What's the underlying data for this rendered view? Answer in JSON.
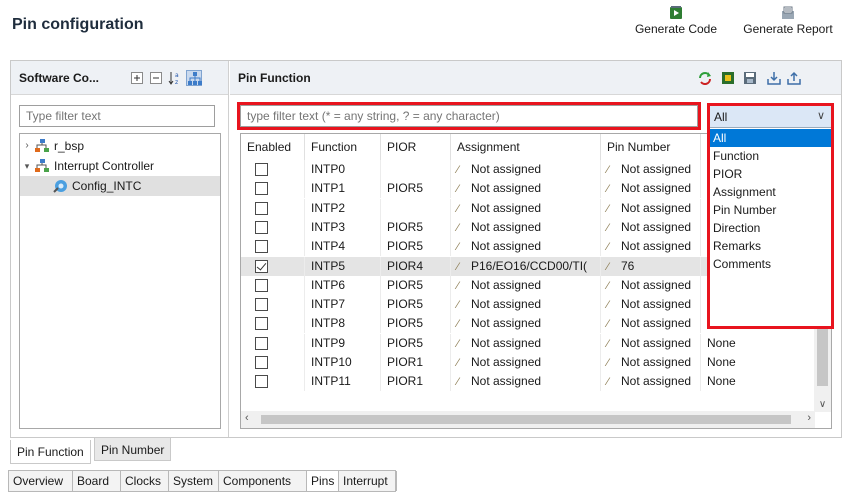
{
  "header": {
    "title": "Pin configuration",
    "generate_code": "Generate Code",
    "generate_report": "Generate Report"
  },
  "left_panel": {
    "title": "Software Co...",
    "filter_placeholder": "Type filter text",
    "tree": [
      {
        "label": "r_bsp",
        "expanded": false,
        "icon": "component-icon"
      },
      {
        "label": "Interrupt Controller",
        "expanded": true,
        "icon": "component-icon"
      },
      {
        "label": "Config_INTC",
        "icon": "config-icon",
        "selected": true
      }
    ]
  },
  "right_panel": {
    "title": "Pin Function",
    "filter_placeholder": "type filter text (* = any string, ? = any character)",
    "combo": {
      "value": "All",
      "options": [
        "All",
        "Function",
        "PIOR",
        "Assignment",
        "Pin Number",
        "Direction",
        "Remarks",
        "Comments"
      ],
      "selected_index": 0
    },
    "columns": [
      "Enabled",
      "Function",
      "PIOR",
      "Assignment",
      "Pin Number"
    ],
    "rows": [
      {
        "enabled": false,
        "function": "INTP0",
        "pior": "",
        "assignment": "Not assigned",
        "pin": "Not assigned",
        "dir": ""
      },
      {
        "enabled": false,
        "function": "INTP1",
        "pior": "PIOR5",
        "assignment": "Not assigned",
        "pin": "Not assigned",
        "dir": ""
      },
      {
        "enabled": false,
        "function": "INTP2",
        "pior": "",
        "assignment": "Not assigned",
        "pin": "Not assigned",
        "dir": ""
      },
      {
        "enabled": false,
        "function": "INTP3",
        "pior": "PIOR5",
        "assignment": "Not assigned",
        "pin": "Not assigned",
        "dir": ""
      },
      {
        "enabled": false,
        "function": "INTP4",
        "pior": "PIOR5",
        "assignment": "Not assigned",
        "pin": "Not assigned",
        "dir": ""
      },
      {
        "enabled": true,
        "function": "INTP5",
        "pior": "PIOR4",
        "assignment": "P16/EO16/CCD00/TI(",
        "pin": "76",
        "dir": ""
      },
      {
        "enabled": false,
        "function": "INTP6",
        "pior": "PIOR5",
        "assignment": "Not assigned",
        "pin": "Not assigned",
        "dir": "None"
      },
      {
        "enabled": false,
        "function": "INTP7",
        "pior": "PIOR5",
        "assignment": "Not assigned",
        "pin": "Not assigned",
        "dir": "None"
      },
      {
        "enabled": false,
        "function": "INTP8",
        "pior": "PIOR5",
        "assignment": "Not assigned",
        "pin": "Not assigned",
        "dir": "None"
      },
      {
        "enabled": false,
        "function": "INTP9",
        "pior": "PIOR5",
        "assignment": "Not assigned",
        "pin": "Not assigned",
        "dir": "None"
      },
      {
        "enabled": false,
        "function": "INTP10",
        "pior": "PIOR1",
        "assignment": "Not assigned",
        "pin": "Not assigned",
        "dir": "None"
      },
      {
        "enabled": false,
        "function": "INTP11",
        "pior": "PIOR1",
        "assignment": "Not assigned",
        "pin": "Not assigned",
        "dir": "None"
      }
    ]
  },
  "inner_tabs": [
    "Pin Function",
    "Pin Number"
  ],
  "editor_tabs": [
    "Overview",
    "Board",
    "Clocks",
    "System",
    "Components",
    "Pins",
    "Interrupt"
  ],
  "active_editor_tab": "Pins",
  "colors": {
    "highlight_box": "#e8141e",
    "selected_option": "#0078d7",
    "panel_bar": "#eef1f5"
  }
}
